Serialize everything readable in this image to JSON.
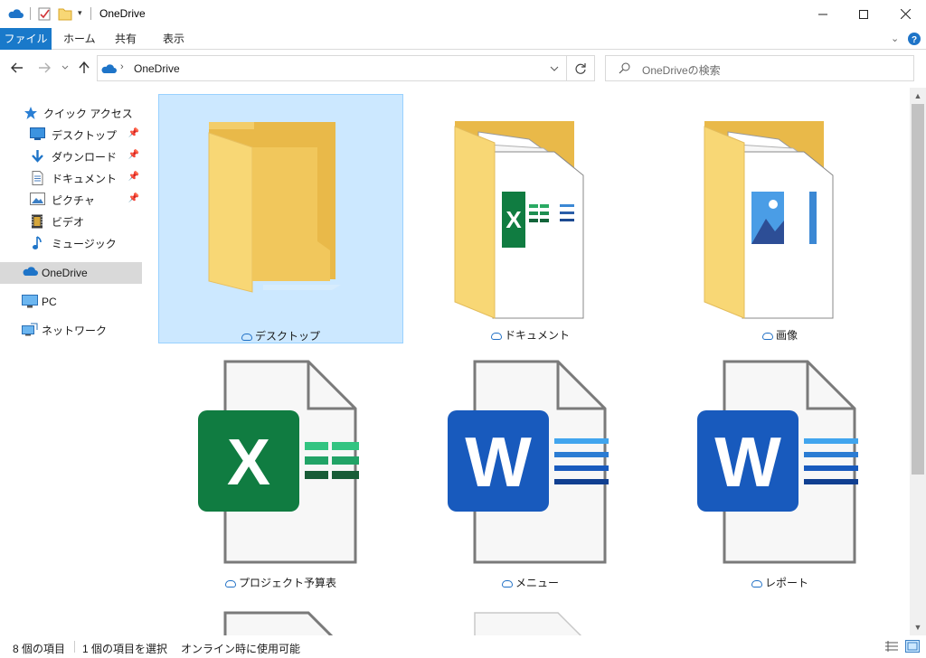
{
  "window": {
    "title": "OneDrive"
  },
  "ribbon": {
    "tabs": [
      "ファイル",
      "ホーム",
      "共有",
      "表示"
    ]
  },
  "address": {
    "path": "OneDrive"
  },
  "search": {
    "placeholder": "OneDriveの検索"
  },
  "sidebar": {
    "items": [
      {
        "label": "クイック アクセス",
        "icon": "star-icon"
      },
      {
        "label": "デスクトップ",
        "icon": "desktop-icon",
        "pinned": true
      },
      {
        "label": "ダウンロード",
        "icon": "download-icon",
        "pinned": true
      },
      {
        "label": "ドキュメント",
        "icon": "document-icon",
        "pinned": true
      },
      {
        "label": "ピクチャ",
        "icon": "picture-icon",
        "pinned": true
      },
      {
        "label": "ビデオ",
        "icon": "video-icon"
      },
      {
        "label": "ミュージック",
        "icon": "music-icon"
      },
      {
        "label": "OneDrive",
        "icon": "onedrive-icon",
        "selected": true
      },
      {
        "label": "PC",
        "icon": "pc-icon"
      },
      {
        "label": "ネットワーク",
        "icon": "network-icon"
      }
    ]
  },
  "files": [
    {
      "name": "デスクトップ",
      "kind": "folder-empty",
      "selected": true
    },
    {
      "name": "ドキュメント",
      "kind": "folder-docs"
    },
    {
      "name": "画像",
      "kind": "folder-pictures"
    },
    {
      "name": "プロジェクト予算表",
      "kind": "excel"
    },
    {
      "name": "メニュー",
      "kind": "word"
    },
    {
      "name": "レポート",
      "kind": "word"
    }
  ],
  "status": {
    "count": "8 個の項目",
    "selection": "1 個の項目を選択",
    "availability": "オンライン時に使用可能"
  },
  "colors": {
    "accent": "#1979ca",
    "selection_bg": "#cce8ff",
    "excel_green": "#107c41",
    "word_blue": "#185abd",
    "folder_yellow": "#f8d775"
  }
}
